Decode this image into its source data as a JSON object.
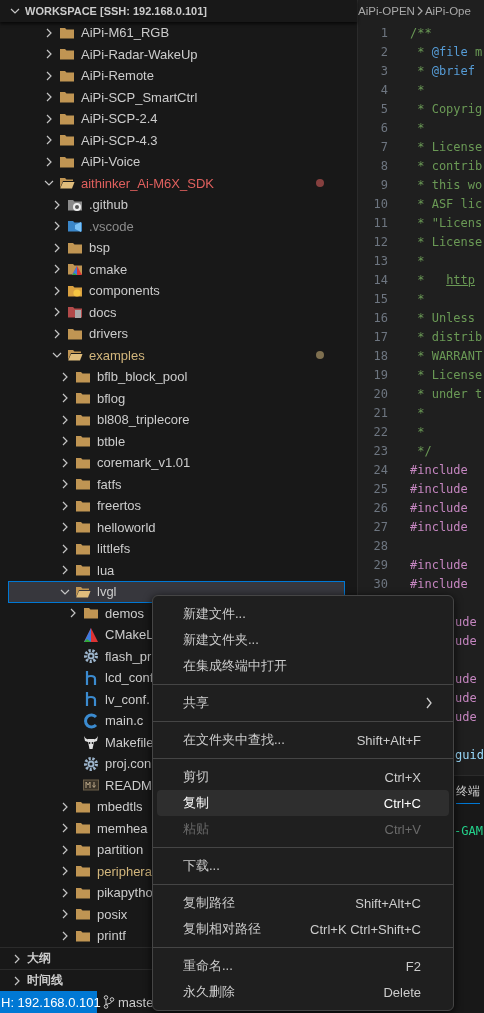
{
  "explorer": {
    "title": "WORKSPACE [SSH: 192.168.0.101]",
    "expanded": true,
    "tree": [
      {
        "label": "AiPi-M61_RGB",
        "kind": "folder",
        "expanded": false,
        "selected": false
      },
      {
        "label": "AiPi-Radar-WakeUp",
        "kind": "folder",
        "expanded": false,
        "selected": false
      },
      {
        "label": "AiPi-Remote",
        "kind": "folder",
        "expanded": false,
        "selected": false
      },
      {
        "label": "AiPi-SCP_SmartCtrl",
        "kind": "folder",
        "expanded": false,
        "selected": false
      },
      {
        "label": "AiPi-SCP-2.4",
        "kind": "folder",
        "expanded": false,
        "selected": false
      },
      {
        "label": "AiPi-SCP-4.3",
        "kind": "folder",
        "expanded": false,
        "selected": false
      },
      {
        "label": "AiPi-Voice",
        "kind": "folder",
        "expanded": false,
        "selected": false
      },
      {
        "label": "aithinker_Ai-M6X_SDK",
        "kind": "folder",
        "expanded": true,
        "selected": false,
        "badge": true,
        "color": "#e0605e",
        "children": [
          {
            "label": ".github",
            "kind": "github-folder",
            "expanded": false,
            "selected": false
          },
          {
            "label": ".vscode",
            "kind": "vscode-folder",
            "expanded": false,
            "selected": false,
            "color": "#8c8c8c"
          },
          {
            "label": "bsp",
            "kind": "folder",
            "expanded": false,
            "selected": false
          },
          {
            "label": "cmake",
            "kind": "cmake-folder",
            "expanded": false,
            "selected": false
          },
          {
            "label": "components",
            "kind": "components-folder",
            "expanded": false,
            "selected": false
          },
          {
            "label": "docs",
            "kind": "docs-folder",
            "expanded": false,
            "selected": false
          },
          {
            "label": "drivers",
            "kind": "folder",
            "expanded": false,
            "selected": false
          },
          {
            "label": "examples",
            "kind": "folder",
            "expanded": true,
            "selected": false,
            "badge": true,
            "color": "#d2b67c",
            "children": [
              {
                "label": "bflb_block_pool",
                "kind": "folder",
                "expanded": false,
                "selected": false
              },
              {
                "label": "bflog",
                "kind": "folder",
                "expanded": false,
                "selected": false
              },
              {
                "label": "bl808_triplecore",
                "kind": "folder",
                "expanded": false,
                "selected": false
              },
              {
                "label": "btble",
                "kind": "folder",
                "expanded": false,
                "selected": false
              },
              {
                "label": "coremark_v1.01",
                "kind": "folder",
                "expanded": false,
                "selected": false
              },
              {
                "label": "fatfs",
                "kind": "folder",
                "expanded": false,
                "selected": false
              },
              {
                "label": "freertos",
                "kind": "folder",
                "expanded": false,
                "selected": false
              },
              {
                "label": "helloworld",
                "kind": "folder",
                "expanded": false,
                "selected": false
              },
              {
                "label": "littlefs",
                "kind": "folder",
                "expanded": false,
                "selected": false
              },
              {
                "label": "lua",
                "kind": "folder",
                "expanded": false,
                "selected": false
              },
              {
                "label": "lvgl",
                "kind": "folder",
                "expanded": true,
                "selected": true,
                "children": [
                  {
                    "label": "demos",
                    "kind": "folder",
                    "expanded": false,
                    "selected": false
                  },
                  {
                    "label": "CMakeL",
                    "kind": "cmake-file",
                    "selected": false
                  },
                  {
                    "label": "flash_pr",
                    "kind": "settings-file",
                    "selected": false
                  },
                  {
                    "label": "lcd_conf",
                    "kind": "header-file",
                    "selected": false
                  },
                  {
                    "label": "lv_conf.",
                    "kind": "header-file",
                    "selected": false
                  },
                  {
                    "label": "main.c",
                    "kind": "c-file",
                    "selected": false
                  },
                  {
                    "label": "Makefile",
                    "kind": "makefile",
                    "selected": false
                  },
                  {
                    "label": "proj.con",
                    "kind": "settings-file",
                    "selected": false
                  },
                  {
                    "label": "READM",
                    "kind": "markdown-file",
                    "selected": false
                  }
                ]
              },
              {
                "label": "mbedtls",
                "kind": "folder",
                "expanded": false,
                "selected": false
              },
              {
                "label": "memhea",
                "kind": "folder",
                "expanded": false,
                "selected": false
              },
              {
                "label": "partition",
                "kind": "folder",
                "expanded": false,
                "selected": false
              },
              {
                "label": "periphera",
                "kind": "folder",
                "expanded": false,
                "selected": false,
                "color": "#d2b67c"
              },
              {
                "label": "pikapytho",
                "kind": "folder",
                "expanded": false,
                "selected": false
              },
              {
                "label": "posix",
                "kind": "folder",
                "expanded": false,
                "selected": false
              },
              {
                "label": "printf",
                "kind": "folder",
                "expanded": false,
                "selected": false
              }
            ]
          }
        ]
      }
    ]
  },
  "side_sections": [
    {
      "label": "大纲",
      "expanded": false
    },
    {
      "label": "时间线",
      "expanded": false
    }
  ],
  "editor": {
    "breadcrumb": [
      "AiPi-OPEN",
      "AiPi-Ope"
    ],
    "lines": [
      {
        "number": "1",
        "segments": [
          {
            "text": "/**",
            "kind": "comment"
          }
        ]
      },
      {
        "number": "2",
        "segments": [
          {
            "text": " * ",
            "kind": "comment"
          },
          {
            "text": "@file",
            "kind": "tag"
          },
          {
            "text": " m",
            "kind": "comment"
          }
        ]
      },
      {
        "number": "3",
        "segments": [
          {
            "text": " * ",
            "kind": "comment"
          },
          {
            "text": "@brief",
            "kind": "tag"
          }
        ]
      },
      {
        "number": "4",
        "segments": [
          {
            "text": " *",
            "kind": "comment"
          }
        ]
      },
      {
        "number": "5",
        "segments": [
          {
            "text": " * Copyrig",
            "kind": "comment"
          }
        ]
      },
      {
        "number": "6",
        "segments": [
          {
            "text": " *",
            "kind": "comment"
          }
        ]
      },
      {
        "number": "7",
        "segments": [
          {
            "text": " * License",
            "kind": "comment"
          }
        ]
      },
      {
        "number": "8",
        "segments": [
          {
            "text": " * contrib",
            "kind": "comment"
          }
        ]
      },
      {
        "number": "9",
        "segments": [
          {
            "text": " * this wo",
            "kind": "comment"
          }
        ]
      },
      {
        "number": "10",
        "segments": [
          {
            "text": " * ASF lic",
            "kind": "comment"
          }
        ]
      },
      {
        "number": "11",
        "segments": [
          {
            "text": " * \"Licens",
            "kind": "comment"
          }
        ]
      },
      {
        "number": "12",
        "segments": [
          {
            "text": " * License",
            "kind": "comment"
          }
        ]
      },
      {
        "number": "13",
        "segments": [
          {
            "text": " *",
            "kind": "comment"
          }
        ]
      },
      {
        "number": "14",
        "segments": [
          {
            "text": " *   ",
            "kind": "comment"
          },
          {
            "text": "http",
            "kind": "link"
          }
        ]
      },
      {
        "number": "15",
        "segments": [
          {
            "text": " *",
            "kind": "comment"
          }
        ]
      },
      {
        "number": "16",
        "segments": [
          {
            "text": " * Unless",
            "kind": "comment"
          }
        ]
      },
      {
        "number": "17",
        "segments": [
          {
            "text": " * distrib",
            "kind": "comment"
          }
        ]
      },
      {
        "number": "18",
        "segments": [
          {
            "text": " * WARRANT",
            "kind": "comment"
          }
        ]
      },
      {
        "number": "19",
        "segments": [
          {
            "text": " * License",
            "kind": "comment"
          }
        ]
      },
      {
        "number": "20",
        "segments": [
          {
            "text": " * under t",
            "kind": "comment"
          }
        ]
      },
      {
        "number": "21",
        "segments": [
          {
            "text": " *",
            "kind": "comment"
          }
        ]
      },
      {
        "number": "22",
        "segments": [
          {
            "text": " *",
            "kind": "comment"
          }
        ]
      },
      {
        "number": "23",
        "segments": [
          {
            "text": " */",
            "kind": "comment"
          }
        ]
      },
      {
        "number": "24",
        "segments": [
          {
            "text": "#include",
            "kind": "keyword"
          }
        ]
      },
      {
        "number": "25",
        "segments": [
          {
            "text": "#include",
            "kind": "keyword"
          }
        ]
      },
      {
        "number": "26",
        "segments": [
          {
            "text": "#include",
            "kind": "keyword"
          }
        ]
      },
      {
        "number": "27",
        "segments": [
          {
            "text": "#include",
            "kind": "keyword"
          }
        ]
      },
      {
        "number": "28"
      },
      {
        "number": "29",
        "segments": [
          {
            "text": "#include",
            "kind": "keyword"
          }
        ]
      },
      {
        "number": "30",
        "segments": [
          {
            "text": "#include",
            "kind": "keyword"
          }
        ]
      }
    ],
    "covered_lines": [
      {
        "kind": "blank"
      },
      {
        "text": "ude",
        "kind": "keyword"
      },
      {
        "text": "ude",
        "kind": "keyword"
      },
      {
        "kind": "blank"
      },
      {
        "text": "ude",
        "kind": "keyword"
      },
      {
        "text": "ude",
        "kind": "keyword"
      },
      {
        "text": "ude",
        "kind": "keyword"
      },
      {
        "kind": "blank"
      },
      {
        "text": "guid",
        "kind": "function"
      }
    ]
  },
  "panel": {
    "tab": "终端",
    "output": "-GAM"
  },
  "context_menu": {
    "groups": [
      [
        {
          "label": "新建文件...",
          "selected": false,
          "disabled": false,
          "submenu": false
        },
        {
          "label": "新建文件夹...",
          "selected": false,
          "disabled": false,
          "submenu": false
        },
        {
          "label": "在集成终端中打开",
          "selected": false,
          "disabled": false,
          "submenu": false
        }
      ],
      [
        {
          "label": "共享",
          "selected": false,
          "disabled": false,
          "submenu": true
        }
      ],
      [
        {
          "label": "在文件夹中查找...",
          "shortcut": "Shift+Alt+F",
          "selected": false,
          "disabled": false,
          "submenu": false
        }
      ],
      [
        {
          "label": "剪切",
          "shortcut": "Ctrl+X",
          "selected": false,
          "disabled": false,
          "submenu": false
        },
        {
          "label": "复制",
          "shortcut": "Ctrl+C",
          "selected": true,
          "disabled": false,
          "submenu": false
        },
        {
          "label": "粘贴",
          "shortcut": "Ctrl+V",
          "selected": false,
          "disabled": true,
          "submenu": false
        }
      ],
      [
        {
          "label": "下载...",
          "selected": false,
          "disabled": false,
          "submenu": false
        }
      ],
      [
        {
          "label": "复制路径",
          "shortcut": "Shift+Alt+C",
          "selected": false,
          "disabled": false,
          "submenu": false
        },
        {
          "label": "复制相对路径",
          "shortcut": "Ctrl+K Ctrl+Shift+C",
          "selected": false,
          "disabled": false,
          "submenu": false
        }
      ],
      [
        {
          "label": "重命名...",
          "shortcut": "F2",
          "selected": false,
          "disabled": false,
          "submenu": false
        },
        {
          "label": "永久删除",
          "shortcut": "Delete",
          "selected": false,
          "disabled": false,
          "submenu": false
        }
      ]
    ]
  },
  "status_bar": {
    "remote": "H: 192.168.0.101",
    "branch": "maste"
  }
}
